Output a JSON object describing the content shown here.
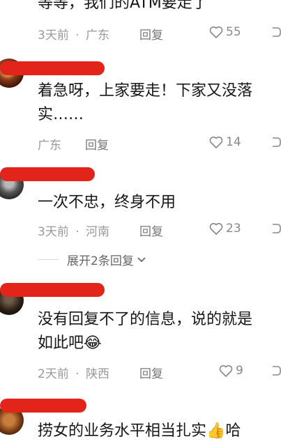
{
  "comments": [
    {
      "text_lines": [
        "等等，我们的ATM要走了"
      ],
      "time": "3天前",
      "location": "广东",
      "reply_label": "回复",
      "likes": "55"
    },
    {
      "text_lines": [
        "着急呀，上家要走！下家又没落",
        "实……"
      ],
      "time": "",
      "location": "广东",
      "reply_label": "回复",
      "likes": "14"
    },
    {
      "text_lines": [
        "一次不忠，终身不用"
      ],
      "time": "3天前",
      "location": "河南",
      "reply_label": "回复",
      "likes": "23"
    },
    {
      "text_lines": [
        "没有回复不了的信息，说的就是",
        "如此吧"
      ],
      "emoji": "😂",
      "time": "2天前",
      "location": "陕西",
      "reply_label": "回复",
      "likes": "9"
    },
    {
      "text_lines": [
        "捞女的业务水平相当扎实"
      ],
      "emoji": "👍",
      "trailing_text": "哈",
      "time": "",
      "location": "",
      "reply_label": "",
      "likes": ""
    }
  ],
  "expand_replies_label": "展开2条回复",
  "separator": "·",
  "colors": {
    "redaction": "#e3241b",
    "meta": "#999999",
    "text": "#161616"
  }
}
